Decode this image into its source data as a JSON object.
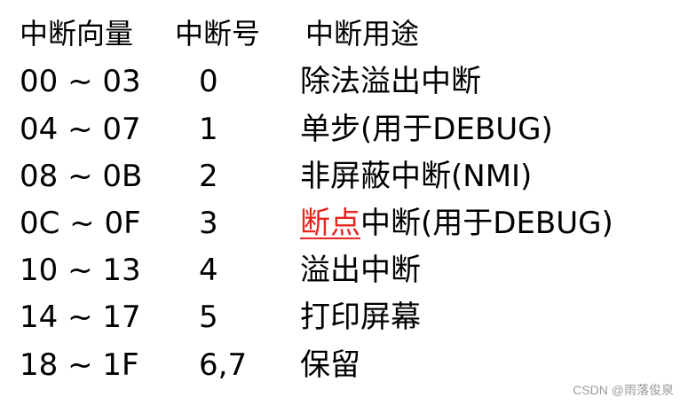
{
  "header": {
    "vector": "中断向量",
    "number": "中断号",
    "purpose": "中断用途"
  },
  "rows": [
    {
      "vector": "00 ~ 03",
      "number": "0",
      "purpose": "除法溢出中断"
    },
    {
      "vector": "04 ~ 07",
      "number": "1",
      "purpose": "单步(用于DEBUG)"
    },
    {
      "vector": "08 ~ 0B",
      "number": "2",
      "purpose": "非屏蔽中断(NMI)"
    },
    {
      "vector": "0C ~ 0F",
      "number": "3",
      "purpose_highlight": "断点",
      "purpose_rest": "中断(用于DEBUG)"
    },
    {
      "vector": "10 ~ 13",
      "number": "4",
      "purpose": "溢出中断"
    },
    {
      "vector": "14 ~ 17",
      "number": "5",
      "purpose": "打印屏幕"
    },
    {
      "vector": "18 ~ 1F",
      "number": "6,7",
      "purpose": "保留"
    }
  ],
  "watermark": "CSDN @雨落俊泉",
  "colors": {
    "text": "#000000",
    "highlight": "#e8251f",
    "watermark": "#9a9a9a",
    "background": "#ffffff"
  }
}
